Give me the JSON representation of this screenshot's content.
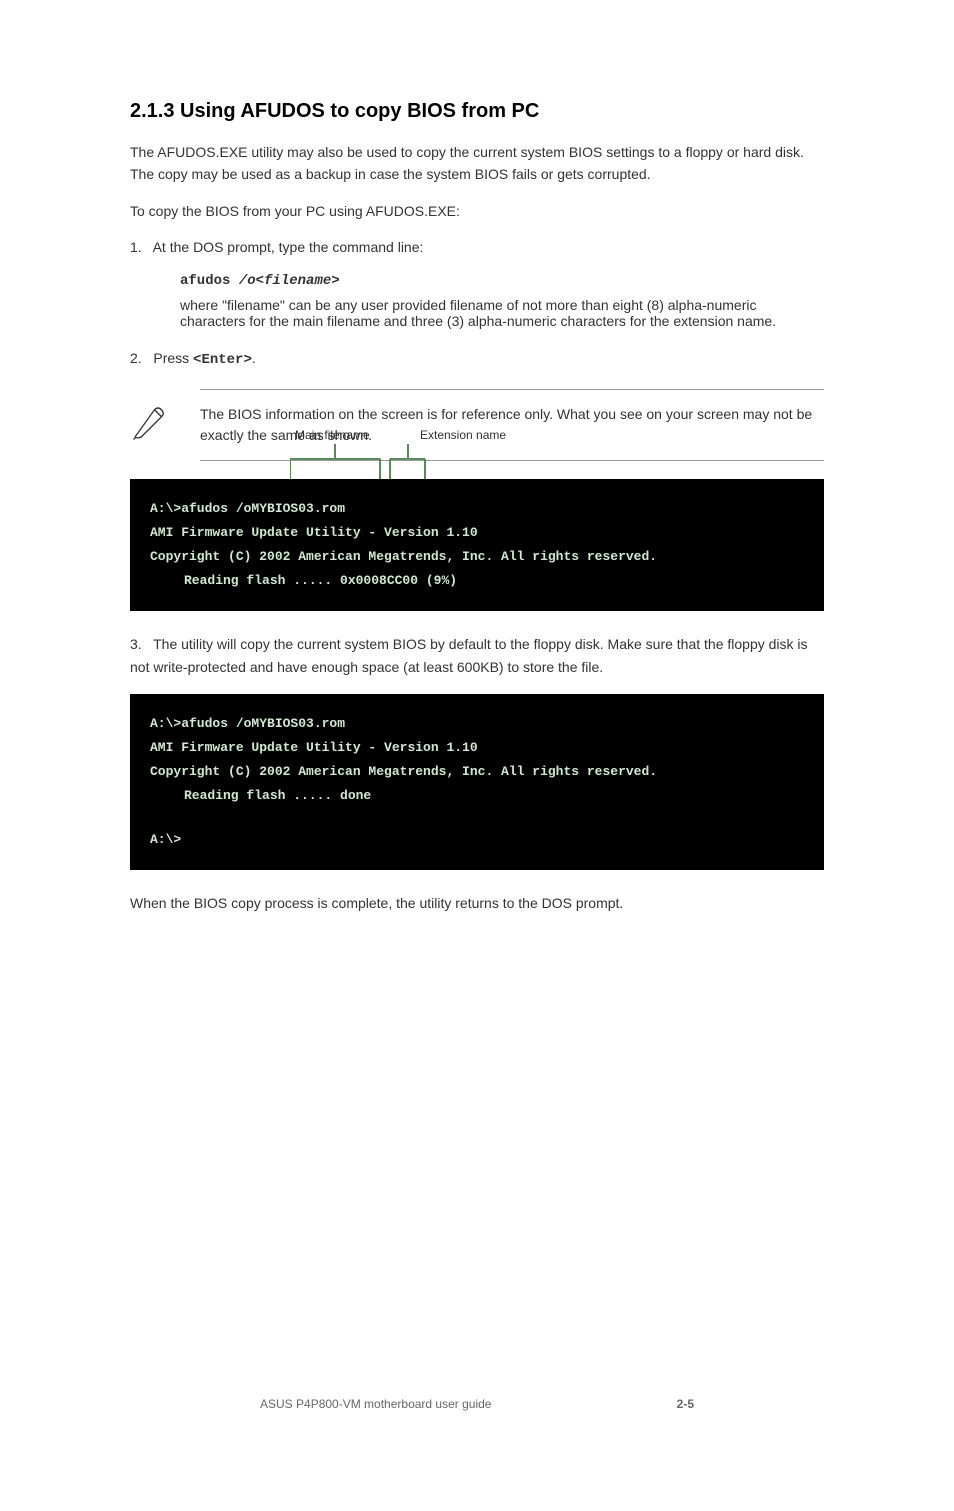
{
  "section_title": "2.1.3 Using AFUDOS to copy BIOS from PC",
  "para1": "The AFUDOS.EXE utility may also be used to copy the current system BIOS settings to a floppy or hard disk. The copy may be used as a backup in case the system BIOS fails or gets corrupted.",
  "step1_intro": "To copy the BIOS from your PC using AFUDOS.EXE:",
  "step1_text": "At the DOS prompt, type the command line:",
  "step1_prefix": "1.",
  "command": "afudos /o<filename>",
  "syntax_pre": "where \"filename\" can be any user provided filename of not more than eight (8) alpha-numeric characters for the main filename and three (3) alpha-numeric characters for the extension name.",
  "step2_prefix": "2.",
  "step2_text": "Press <Enter>.",
  "note": "The BIOS information on the screen is for reference only. What you see on your screen may not be exactly the same as shown.",
  "label_main": "Main filename",
  "label_ext": "Extension name",
  "terminal1": {
    "line1": "A:\\>afudos /oMYBIOS03.rom",
    "line2": "AMI Firmware Update Utility - Version 1.10",
    "line3": "Copyright (C) 2002 American Megatrends, Inc. All rights reserved.",
    "line4": "Reading flash ..... 0x0008CC00 (9%)"
  },
  "step3_prefix": "3.",
  "step3_text": "The utility will copy the current system BIOS by default to the floppy disk. Make sure that the floppy disk is not write-protected and have enough space (at least 600KB) to store the file.",
  "terminal2": {
    "line1": "A:\\>afudos /oMYBIOS03.rom",
    "line2": "AMI Firmware Update Utility - Version 1.10",
    "line3": "Copyright (C) 2002 American Megatrends, Inc. All rights reserved.",
    "line4": "Reading flash ..... done",
    "line5": "A:\\>"
  },
  "closing": "When the BIOS copy process is complete, the utility returns to the DOS prompt.",
  "footer_left": "ASUS P4P800-VM motherboard user guide",
  "footer_right": "2-5"
}
